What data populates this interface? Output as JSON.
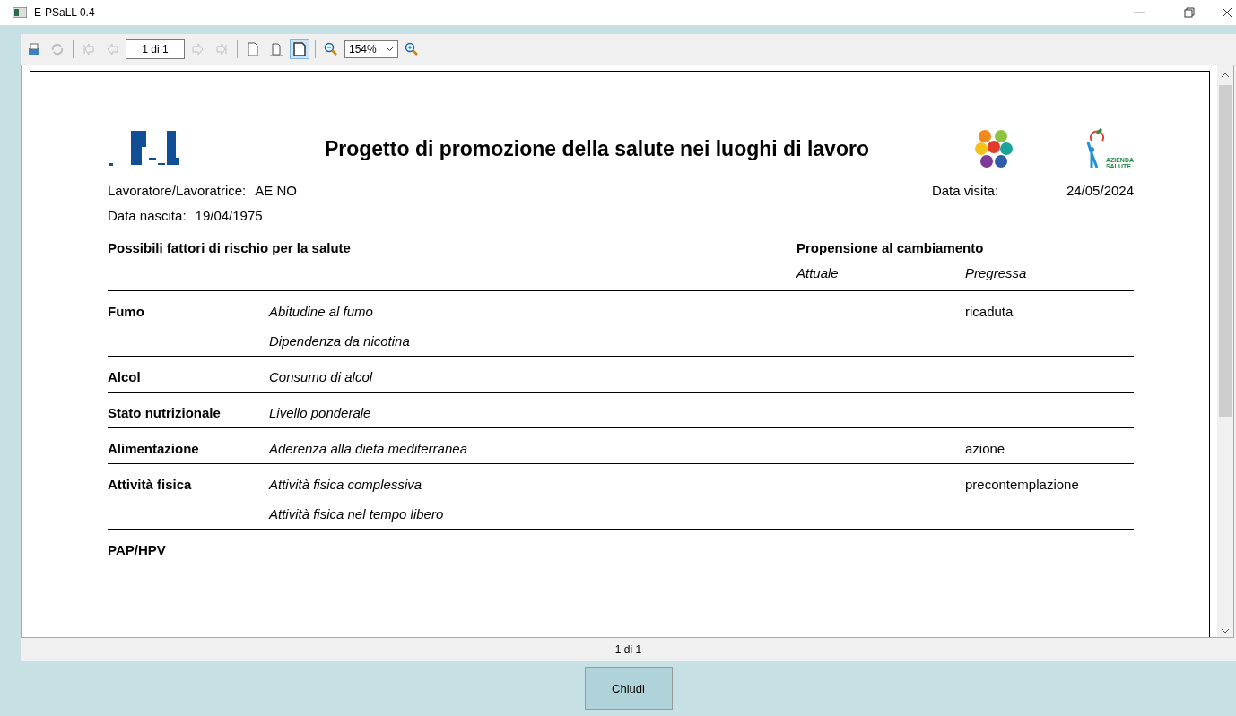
{
  "window": {
    "title": "E-PSaLL 0.4"
  },
  "toolbar": {
    "items": [
      {
        "kind": "print",
        "disabled": false,
        "selected": false
      },
      {
        "kind": "refresh",
        "disabled": true,
        "selected": false
      },
      {
        "kind": "sep"
      },
      {
        "kind": "first",
        "disabled": true,
        "selected": false
      },
      {
        "kind": "prev",
        "disabled": true,
        "selected": false
      },
      {
        "kind": "page",
        "value": "1 di 1"
      },
      {
        "kind": "next",
        "disabled": true,
        "selected": false
      },
      {
        "kind": "last",
        "disabled": true,
        "selected": false
      },
      {
        "kind": "sep"
      },
      {
        "kind": "single-page",
        "disabled": false,
        "selected": false
      },
      {
        "kind": "page-width",
        "disabled": false,
        "selected": false
      },
      {
        "kind": "whole-page",
        "disabled": false,
        "selected": true
      },
      {
        "kind": "sep"
      },
      {
        "kind": "zoom-out",
        "disabled": false,
        "selected": false
      },
      {
        "kind": "zoom",
        "value": "154%"
      },
      {
        "kind": "zoom-in",
        "disabled": false,
        "selected": false
      }
    ]
  },
  "report": {
    "title": "Progetto di promozione della salute nei luoghi di lavoro",
    "logo_right_text": [
      "AZIENDA",
      "SALUTE"
    ],
    "worker": {
      "label": "Lavoratore/Lavoratrice:",
      "value": "AE NO"
    },
    "visit_date": {
      "label": "Data visita:",
      "value": "24/05/2024"
    },
    "birth_date": {
      "label": "Data nascita:",
      "value": "19/04/1975"
    },
    "header": {
      "factors": "Possibili fattori di rischio per la salute",
      "propensity": "Propensione al cambiamento",
      "current": "Attuale",
      "past": "Pregressa"
    },
    "rows": [
      {
        "factor": "Fumo",
        "items": [
          {
            "name": "Abitudine al fumo",
            "past": "ricaduta"
          },
          {
            "name": "Dipendenza da nicotina"
          }
        ]
      },
      {
        "factor": "Alcol",
        "items": [
          {
            "name": "Consumo di alcol"
          }
        ]
      },
      {
        "factor": "Stato nutrizionale",
        "items": [
          {
            "name": "Livello ponderale"
          }
        ]
      },
      {
        "factor": "Alimentazione",
        "items": [
          {
            "name": "Aderenza alla dieta mediterranea",
            "past": "azione"
          }
        ]
      },
      {
        "factor": "Attività fisica",
        "items": [
          {
            "name": "Attività fisica complessiva",
            "past": "precontemplazione"
          },
          {
            "name": "Attività fisica nel tempo libero"
          }
        ]
      },
      {
        "factor": "PAP/HPV",
        "items": []
      }
    ]
  },
  "status": "1 di 1",
  "buttons": [
    "Chiudi"
  ]
}
